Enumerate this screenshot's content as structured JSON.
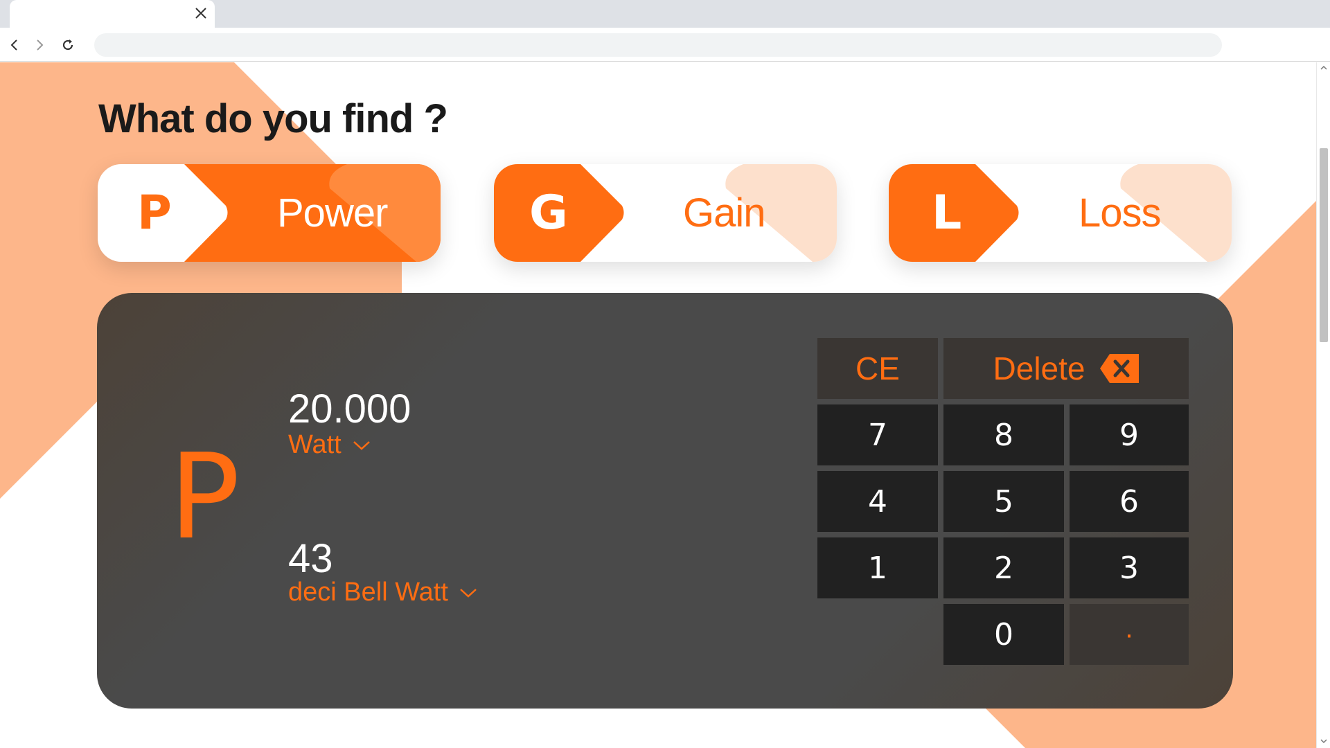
{
  "browser": {
    "url": "",
    "icons": [
      "close-icon",
      "back-arrow-icon",
      "forward-arrow-icon",
      "reload-icon"
    ]
  },
  "page": {
    "heading": "What do you find ?",
    "modes": [
      {
        "letter": "P",
        "label": "Power"
      },
      {
        "letter": "G",
        "label": "Gain"
      },
      {
        "letter": "L",
        "label": "Loss"
      }
    ],
    "selected_mode": "Power"
  },
  "calculator": {
    "symbol": "P",
    "input": {
      "value": "20.000",
      "unit": "Watt"
    },
    "output": {
      "value": "43",
      "unit": "deci Bell Watt"
    },
    "keys": {
      "ce": "CE",
      "delete": "Delete",
      "k7": "7",
      "k8": "8",
      "k9": "9",
      "k4": "4",
      "k5": "5",
      "k6": "6",
      "k1": "1",
      "k2": "2",
      "k3": "3",
      "k0": "0",
      "dot": "·"
    }
  },
  "colors": {
    "accent": "#ff6d12",
    "accent_light": "#fdb68a",
    "accent_pale": "#fde0cc",
    "panel": "#4a4a4a",
    "key": "#212121",
    "key_op": "#3a3633",
    "text_dark": "#1a1a1a"
  }
}
